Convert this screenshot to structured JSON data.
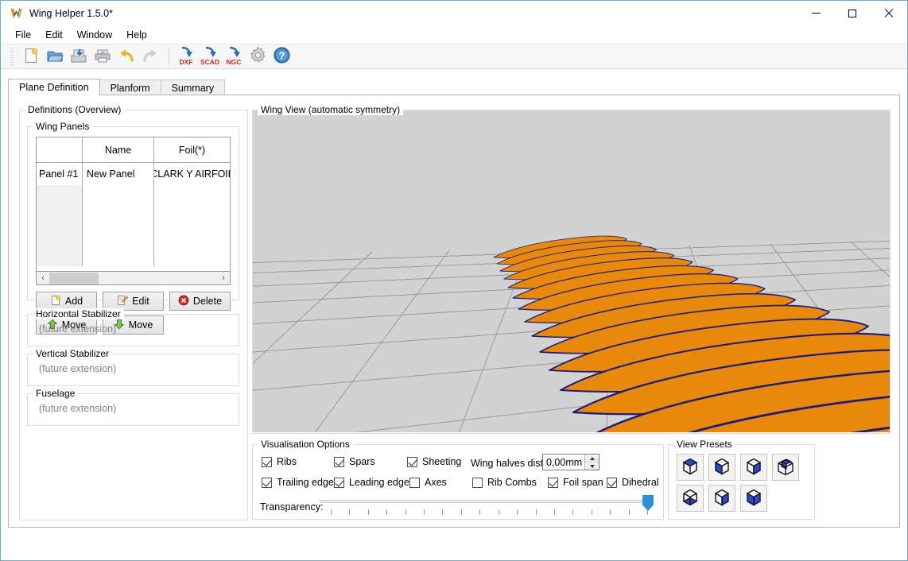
{
  "window": {
    "title": "Wing Helper 1.5.0*",
    "app_icon": "wing-helper-logo-icon",
    "controls": {
      "minimize": "minimize-icon",
      "maximize": "maximize-icon",
      "close": "close-icon"
    }
  },
  "menubar": {
    "items": [
      {
        "label": "File"
      },
      {
        "label": "Edit"
      },
      {
        "label": "Window"
      },
      {
        "label": "Help"
      }
    ]
  },
  "toolbar": {
    "buttons": [
      {
        "name": "new-file-icon",
        "label": ""
      },
      {
        "name": "open-folder-icon",
        "label": ""
      },
      {
        "name": "save-icon",
        "label": ""
      },
      {
        "name": "print-icon",
        "label": ""
      },
      {
        "name": "undo-icon",
        "label": ""
      },
      {
        "name": "redo-icon",
        "label": ""
      },
      {
        "name": "export-dxf-icon",
        "label": "DXF"
      },
      {
        "name": "export-scad-icon",
        "label": "SCAD"
      },
      {
        "name": "export-ngc-icon",
        "label": "NGC"
      },
      {
        "name": "settings-gear-icon",
        "label": ""
      },
      {
        "name": "help-icon",
        "label": ""
      }
    ]
  },
  "tabs": [
    {
      "label": "Plane Definition",
      "active": true
    },
    {
      "label": "Planform",
      "active": false
    },
    {
      "label": "Summary",
      "active": false
    }
  ],
  "definitions": {
    "title": "Definitions (Overview)",
    "wing_panels": {
      "title": "Wing Panels",
      "columns": [
        "",
        "Name",
        "Foil(*)"
      ],
      "rows": [
        {
          "index": "Panel #1",
          "name": "New Panel",
          "foil": "CLARK Y AIRFOIL"
        }
      ],
      "scrollbar": {
        "left_arrow": "‹",
        "right_arrow": "›"
      },
      "buttons": [
        {
          "label": "Add",
          "icon": "add-icon"
        },
        {
          "label": "Edit",
          "icon": "edit-icon"
        },
        {
          "label": "Delete",
          "icon": "delete-icon"
        },
        {
          "label": "Move",
          "icon": "move-up-icon"
        },
        {
          "label": "Move",
          "icon": "move-down-icon"
        }
      ]
    },
    "horizontal_stabilizer": {
      "title": "Horizontal Stabilizer",
      "content": "(future extension)"
    },
    "vertical_stabilizer": {
      "title": "Vertical Stabilizer",
      "content": "(future extension)"
    },
    "fuselage": {
      "title": "Fuselage",
      "content": "(future extension)"
    }
  },
  "wing_view": {
    "title": "Wing View (automatic symmetry)",
    "background": "#d2d2d2",
    "grid_color": "#9b9b9b",
    "rib_fill": "#e8890c",
    "rib_outline": "#1c1c78",
    "rib_count": 16
  },
  "visualisation": {
    "title": "Visualisation Options",
    "checkboxes": [
      {
        "label": "Ribs",
        "checked": true
      },
      {
        "label": "Spars",
        "checked": true
      },
      {
        "label": "Sheeting",
        "checked": true
      },
      {
        "label": "Trailing edge",
        "checked": true
      },
      {
        "label": "Leading edge",
        "checked": true
      },
      {
        "label": "Axes",
        "checked": false
      },
      {
        "label": "Rib Combs",
        "checked": false
      },
      {
        "label": "Foil span",
        "checked": true
      },
      {
        "label": "Dihedral",
        "checked": true
      }
    ],
    "wing_halves": {
      "label": "Wing halves dist.:",
      "value": "0,00mm"
    },
    "transparency": {
      "label": "Transparency:",
      "value": 100,
      "min": 0,
      "max": 100,
      "ticks": 18
    }
  },
  "view_presets": {
    "title": "View Presets",
    "buttons": [
      {
        "name": "view-preset-top-icon"
      },
      {
        "name": "view-preset-front-icon"
      },
      {
        "name": "view-preset-right-icon"
      },
      {
        "name": "view-preset-iso-icon"
      },
      {
        "name": "view-preset-bottom-icon"
      },
      {
        "name": "view-preset-back-icon"
      },
      {
        "name": "view-preset-left-icon"
      }
    ]
  },
  "colors": {
    "accent": "#2f8fd8",
    "rib_orange": "#e8890c",
    "rib_navy": "#1c1c78",
    "gl_background": "#d2d2d2",
    "window_border": "#6fa8c9"
  }
}
